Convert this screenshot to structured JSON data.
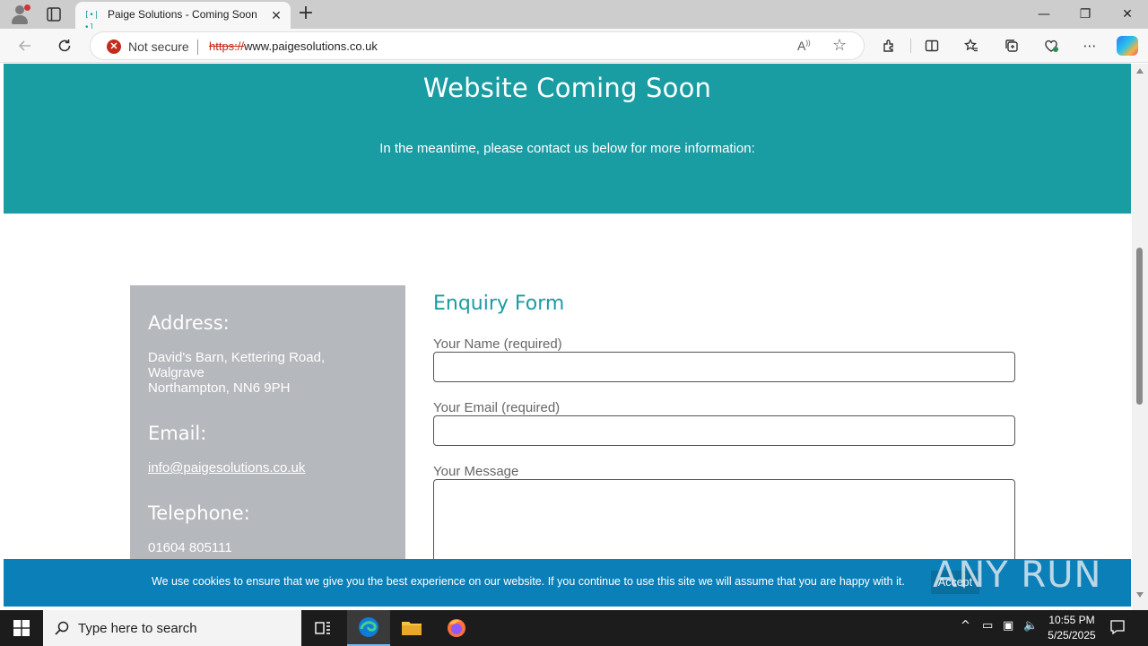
{
  "browser": {
    "tab_title": "Paige Solutions - Coming Soon",
    "tab_favicon": "[•|•]",
    "security_text": "Not secure",
    "url_protocol": "https://",
    "url_host": "www.paigesolutions.co.uk",
    "window_controls": {
      "minimize": "—",
      "restore": "❐",
      "close": "✕"
    },
    "new_tab": "+"
  },
  "page": {
    "hero": {
      "title": "Website Coming Soon",
      "subtitle": "In the meantime, please contact us below for more information:"
    },
    "contact": {
      "address_heading": "Address:",
      "address_line1": "David's Barn, Kettering Road,",
      "address_line2": "Walgrave",
      "address_line3": "Northampton, NN6 9PH",
      "email_heading": "Email:",
      "email": "info@paigesolutions.co.uk",
      "telephone_heading": "Telephone:",
      "telephone": "01604 805111"
    },
    "form": {
      "heading": "Enquiry Form",
      "name_label": "Your Name (required)",
      "name_value": "",
      "email_label": "Your Email (required)",
      "email_value": "",
      "message_label": "Your Message",
      "message_value": ""
    },
    "cookie_bar": {
      "message": "We use cookies to ensure that we give you the best experience on our website. If you continue to use this site we will assume that you are happy with it.",
      "accept_label": "Accept"
    },
    "watermark": "ANY RUN"
  },
  "taskbar": {
    "search_placeholder": "Type here to search",
    "time": "10:55 PM",
    "date": "5/25/2025"
  },
  "colors": {
    "brand_teal": "#1a9ca3",
    "cookie_blue": "#0b7fb8",
    "panel_gray": "#b5b8bc",
    "insecure_red": "#c42b1c"
  }
}
